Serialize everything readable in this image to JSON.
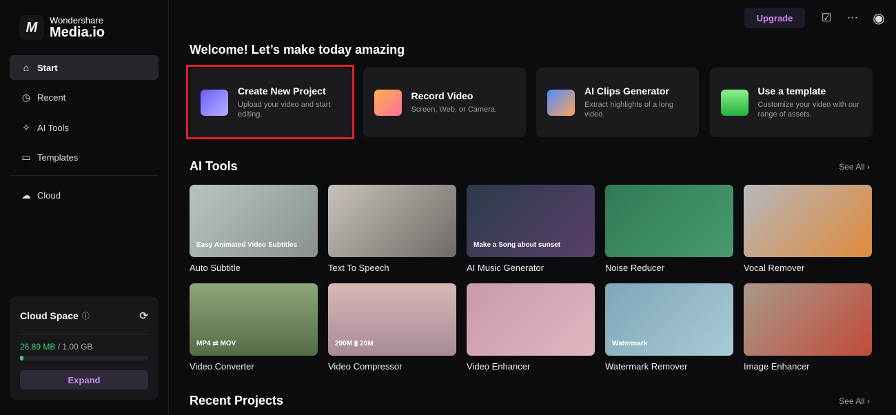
{
  "brand": {
    "line1": "Wondershare",
    "line2": "Media.io",
    "mark": "M"
  },
  "sidebar": {
    "items": [
      {
        "label": "Start",
        "icon": "home-icon",
        "glyph": "⌂"
      },
      {
        "label": "Recent",
        "icon": "clock-icon",
        "glyph": "◷"
      },
      {
        "label": "AI Tools",
        "icon": "sparkle-icon",
        "glyph": "✧"
      },
      {
        "label": "Templates",
        "icon": "layout-icon",
        "glyph": "▭"
      },
      {
        "label": "Cloud",
        "icon": "cloud-icon",
        "glyph": "☁"
      }
    ]
  },
  "cloud": {
    "title": "Cloud Space",
    "used": "26.89 MB",
    "total": " / 1.00 GB",
    "usage_fraction": 0.026,
    "expand": "Expand"
  },
  "topbar": {
    "upgrade": "Upgrade"
  },
  "welcome": "Welcome! Let’s make today amazing",
  "quick": [
    {
      "title": "Create New Project",
      "desc": "Upload your video and start editing.",
      "color": "linear-gradient(135deg,#6a5cff,#b9b0ff)"
    },
    {
      "title": "Record Video",
      "desc": "Screen, Web, or Camera.",
      "color": "linear-gradient(135deg,#ffb347,#ff6fa0)"
    },
    {
      "title": "AI Clips Generator",
      "desc": "Extract highlights of a long video.",
      "color": "linear-gradient(135deg,#4f8bff,#ffa45c)"
    },
    {
      "title": "Use a template",
      "desc": "Customize your video with our range of assets.",
      "color": "linear-gradient(180deg,#8cf08c,#22b33a)"
    }
  ],
  "ai_tools": {
    "title": "AI Tools",
    "see_all": "See All ›",
    "tiles": [
      {
        "label": "Auto Subtitle",
        "overlay": "Easy Animated Video Subtitles",
        "bg": "linear-gradient(135deg,#b9c4c2,#8a9190)"
      },
      {
        "label": "Text To Speech",
        "overlay": "",
        "bg": "linear-gradient(135deg,#c8c2ba,#6e6a66)"
      },
      {
        "label": "AI Music Generator",
        "overlay": "Make a Song about sunset",
        "bg": "linear-gradient(135deg,#2b3b4a,#5a3f6b)"
      },
      {
        "label": "Noise Reducer",
        "overlay": "",
        "bg": "linear-gradient(135deg,#2f7a55,#4a9a70)"
      },
      {
        "label": "Vocal Remover",
        "overlay": "",
        "bg": "linear-gradient(135deg,#b5b8bd,#e08a3a)"
      },
      {
        "label": "Video Converter",
        "overlay": "MP4 ⇄ MOV",
        "bg": "linear-gradient(180deg,#8fa77a,#556b45)"
      },
      {
        "label": "Video Compressor",
        "overlay": "200M ▮ 20M",
        "bg": "linear-gradient(180deg,#d8b9b4,#a88a9a)"
      },
      {
        "label": "Video Enhancer",
        "overlay": "",
        "bg": "linear-gradient(135deg,#c99aa8,#e0b7c0)"
      },
      {
        "label": "Watermark Remover",
        "overlay": "Watermark",
        "bg": "linear-gradient(135deg,#7fa6b8,#a9cbd8)"
      },
      {
        "label": "Image Enhancer",
        "overlay": "",
        "bg": "linear-gradient(135deg,#a89a8a,#c24a3a)"
      }
    ]
  },
  "recent": {
    "title": "Recent Projects",
    "see_all": "See All ›"
  }
}
